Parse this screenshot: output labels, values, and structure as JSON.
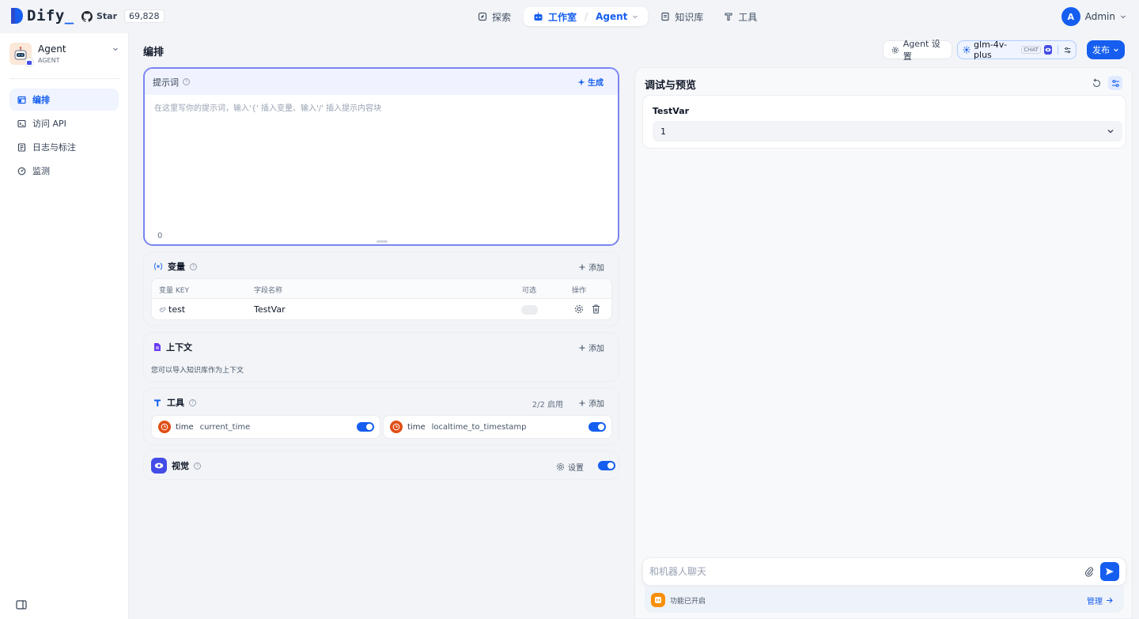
{
  "topbar": {
    "brand": "Dify",
    "star_label": "Star",
    "star_count": "69,828",
    "nav": {
      "explore": "探索",
      "studio": "工作室",
      "studio_app": "Agent",
      "knowledge": "知识库",
      "tools": "工具"
    },
    "user_initial": "A",
    "user_name": "Admin"
  },
  "sidebar": {
    "app_name": "Agent",
    "app_type": "AGENT",
    "items": [
      {
        "label": "编排",
        "icon": "layout-icon",
        "active": true
      },
      {
        "label": "访问 API",
        "icon": "terminal-icon",
        "active": false
      },
      {
        "label": "日志与标注",
        "icon": "file-list-icon",
        "active": false
      },
      {
        "label": "监测",
        "icon": "dashboard-icon",
        "active": false
      }
    ]
  },
  "main": {
    "title": "编排",
    "agent_settings": "Agent 设置",
    "model_name": "glm-4v-plus",
    "model_tag": "CHAT",
    "publish": "发布"
  },
  "prompt": {
    "title": "提示词",
    "generate": "生成",
    "placeholder": "在这里写你的提示词，输入'{' 插入变量、输入'/' 插入提示内容块",
    "count": "0"
  },
  "variables": {
    "title": "变量",
    "add": "添加",
    "columns": {
      "key": "变量 KEY",
      "name": "字段名称",
      "optional": "可选",
      "action": "操作"
    },
    "rows": [
      {
        "key": "test",
        "name": "TestVar",
        "optional": false
      }
    ]
  },
  "context": {
    "title": "上下文",
    "add": "添加",
    "description": "您可以导入知识库作为上下文"
  },
  "tools": {
    "title": "工具",
    "enabled_count": "2/2 启用",
    "add": "添加",
    "items": [
      {
        "provider": "time",
        "name": "current_time",
        "enabled": true
      },
      {
        "provider": "time",
        "name": "localtime_to_timestamp",
        "enabled": true
      }
    ]
  },
  "vision": {
    "title": "视觉",
    "settings": "设置",
    "enabled": true
  },
  "debug": {
    "title": "调试与预览",
    "var_label": "TestVar",
    "var_value": "1",
    "chat_placeholder": "和机器人聊天",
    "features_enabled": "功能已开启",
    "manage": "管理"
  },
  "colors": {
    "primary": "#155eef",
    "tool_icon": "#e04f16",
    "vision_icon": "#444ce7",
    "feature_icon": "#f79009"
  }
}
